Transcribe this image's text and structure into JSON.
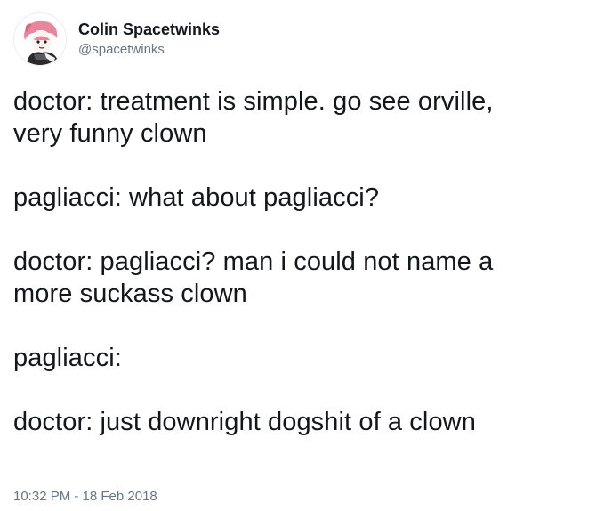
{
  "author": {
    "display_name": "Colin Spacetwinks",
    "handle": "@spacetwinks",
    "avatar_icon": "cartoon-avatar-icon",
    "avatar_hair_color": "#e8879b"
  },
  "tweet": {
    "paragraphs": [
      "doctor: treatment is simple. go see orville,\nvery funny clown",
      "pagliacci: what about pagliacci?",
      "doctor: pagliacci? man i could not name a\nmore suckass clown",
      "pagliacci:",
      "doctor: just downright dogshit of a clown"
    ]
  },
  "timestamp": "10:32 PM - 18 Feb 2018",
  "colors": {
    "text": "#14171a",
    "secondary": "#657786"
  }
}
